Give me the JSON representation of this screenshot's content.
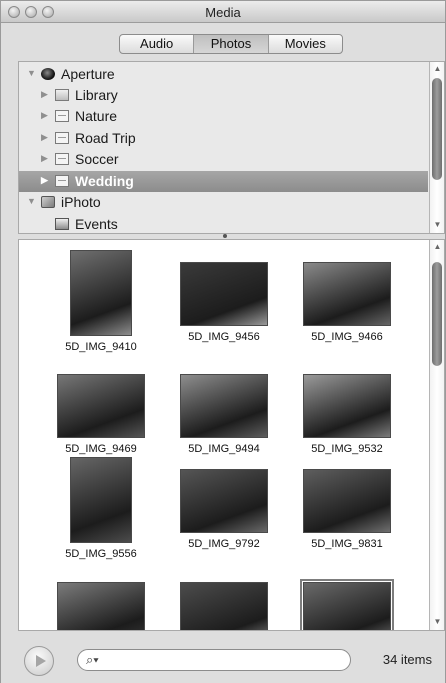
{
  "window": {
    "title": "Media"
  },
  "tabs": [
    {
      "label": "Audio",
      "active": false
    },
    {
      "label": "Photos",
      "active": true
    },
    {
      "label": "Movies",
      "active": false
    }
  ],
  "source_list": [
    {
      "label": "Aperture",
      "icon": "aperture-icon",
      "expanded": true,
      "selected": false
    },
    {
      "label": "Library",
      "icon": "library-icon",
      "expanded": false,
      "selected": false
    },
    {
      "label": "Nature",
      "icon": "album-icon",
      "expanded": false,
      "selected": false
    },
    {
      "label": "Road Trip",
      "icon": "album-icon",
      "expanded": false,
      "selected": false
    },
    {
      "label": "Soccer",
      "icon": "album-icon",
      "expanded": false,
      "selected": false
    },
    {
      "label": "Wedding",
      "icon": "album-icon",
      "expanded": false,
      "selected": true
    },
    {
      "label": "iPhoto",
      "icon": "iphoto-icon",
      "expanded": true,
      "selected": false
    },
    {
      "label": "Events",
      "icon": "events-icon",
      "expanded": false,
      "selected": false
    }
  ],
  "photos": [
    {
      "name": "5D_IMG_9410",
      "orientation": "portrait"
    },
    {
      "name": "5D_IMG_9456",
      "orientation": "landscape"
    },
    {
      "name": "5D_IMG_9466",
      "orientation": "landscape"
    },
    {
      "name": "5D_IMG_9469",
      "orientation": "landscape"
    },
    {
      "name": "5D_IMG_9494",
      "orientation": "landscape"
    },
    {
      "name": "5D_IMG_9532",
      "orientation": "landscape"
    },
    {
      "name": "5D_IMG_9556",
      "orientation": "portrait"
    },
    {
      "name": "5D_IMG_9792",
      "orientation": "landscape"
    },
    {
      "name": "5D_IMG_9831",
      "orientation": "landscape"
    },
    {
      "name": "",
      "orientation": "landscape"
    },
    {
      "name": "",
      "orientation": "landscape"
    },
    {
      "name": "",
      "orientation": "landscape",
      "highlighted": true
    }
  ],
  "footer": {
    "search_value": "",
    "item_count": "34 items"
  }
}
